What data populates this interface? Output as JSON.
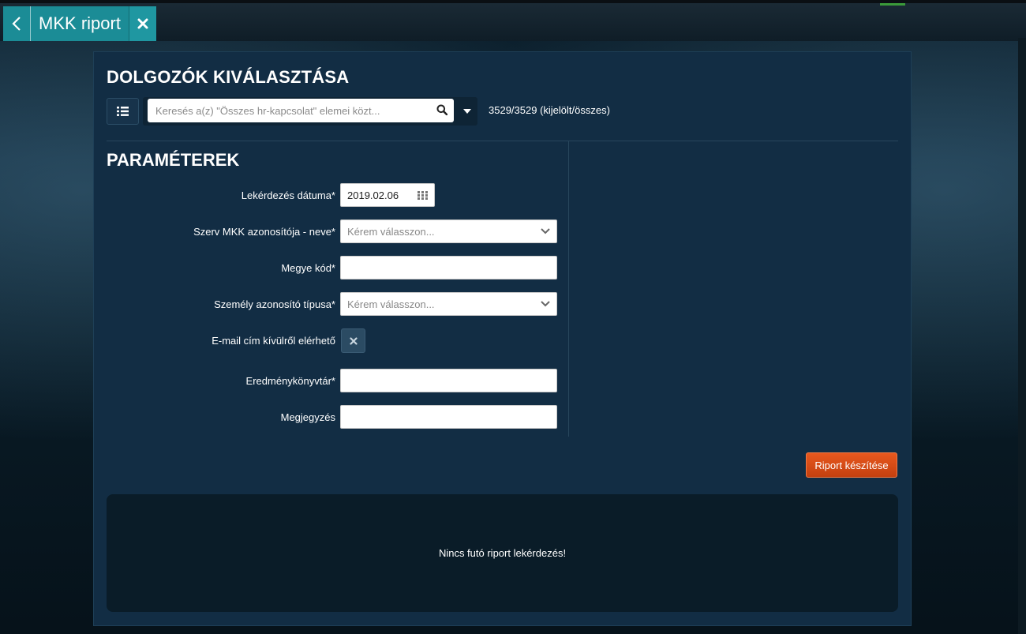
{
  "tab": {
    "title": "MKK riport"
  },
  "selection": {
    "heading": "DOLGOZÓK KIVÁLASZTÁSA",
    "search_placeholder": "Keresés a(z) \"Összes hr-kapcsolat\" elemei közt...",
    "count_text": "3529/3529 (kijelölt/összes)"
  },
  "params": {
    "heading": "PARAMÉTEREK",
    "fields": {
      "date": {
        "label": "Lekérdezés dátuma*",
        "value": "2019.02.06"
      },
      "org": {
        "label": "Szerv MKK azonosítója - neve*",
        "placeholder": "Kérem válasszon..."
      },
      "county": {
        "label": "Megye kód*",
        "value": ""
      },
      "idtype": {
        "label": "Személy azonosító típusa*",
        "placeholder": "Kérem válasszon..."
      },
      "email": {
        "label": "E-mail cím kívülről elérhető",
        "checked": false
      },
      "resultdir": {
        "label": "Eredménykönyvtár*",
        "value": ""
      },
      "note": {
        "label": "Megjegyzés",
        "value": ""
      }
    }
  },
  "actions": {
    "report_button": "Riport készítése"
  },
  "result": {
    "message": "Nincs futó riport lekérdezés!"
  },
  "icons": {
    "back": "chevron-left-icon",
    "close": "close-icon",
    "list": "list-icon",
    "search": "search-icon",
    "dropdown": "caret-down-icon",
    "calendar": "calendar-icon",
    "select": "chevron-down-icon",
    "toggle_off": "x-icon"
  },
  "colors": {
    "tab": "#1b8c96",
    "panel": "#122d44",
    "primary_action": "#dc4f18"
  }
}
